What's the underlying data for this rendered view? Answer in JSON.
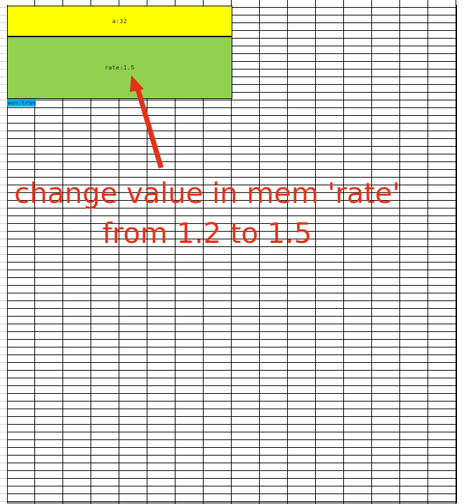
{
  "cells": {
    "a": "a:32",
    "rate": "rate:1.5",
    "won": "won:true"
  },
  "annotation": {
    "line1": "change value in mem 'rate'",
    "line2": "from 1.2 to 1.5"
  },
  "colors": {
    "a_fill": "#ffff00",
    "rate_fill": "#92d050",
    "won_fill": "#00b0f0",
    "annotation": "#e33219"
  },
  "icons": {
    "arrow": "arrow-up-icon"
  }
}
